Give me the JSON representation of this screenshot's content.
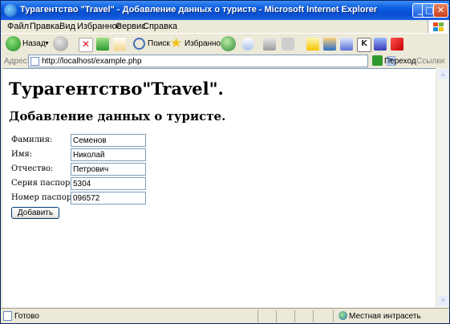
{
  "window": {
    "title": "Турагентство \"Travel\" - Добавление данных о туристе - Microsoft Internet Explorer",
    "buttons": {
      "minimize": "_",
      "maximize": "□",
      "close": "✕"
    }
  },
  "menu": {
    "items": [
      "Файл",
      "Правка",
      "Вид",
      "Избранное",
      "Сервис",
      "Справка"
    ]
  },
  "toolbar": {
    "back_label": "Назад",
    "search_label": "Поиск",
    "favorites_label": "Избранное"
  },
  "address": {
    "label": "Адрес:",
    "url": "http://localhost/example.php",
    "go_label": "Переход",
    "links_label": "Ссылки"
  },
  "page": {
    "title": "Турагентство\"Travel\".",
    "subtitle": "Добавление данных о туристе.",
    "fields": [
      {
        "label": "Фамилия:",
        "value": "Семенов"
      },
      {
        "label": "Имя:",
        "value": "Николай"
      },
      {
        "label": "Отчество:",
        "value": "Петрович"
      },
      {
        "label": "Серия паспорта:",
        "value": "5304"
      },
      {
        "label": "Номер паспорта:",
        "value": "096572"
      }
    ],
    "submit_label": "Добавить"
  },
  "status": {
    "text": "Готово",
    "zone": "Местная интрасеть"
  },
  "colors": {
    "titlebar": "#0a5ce0",
    "chrome": "#ece9d8"
  }
}
